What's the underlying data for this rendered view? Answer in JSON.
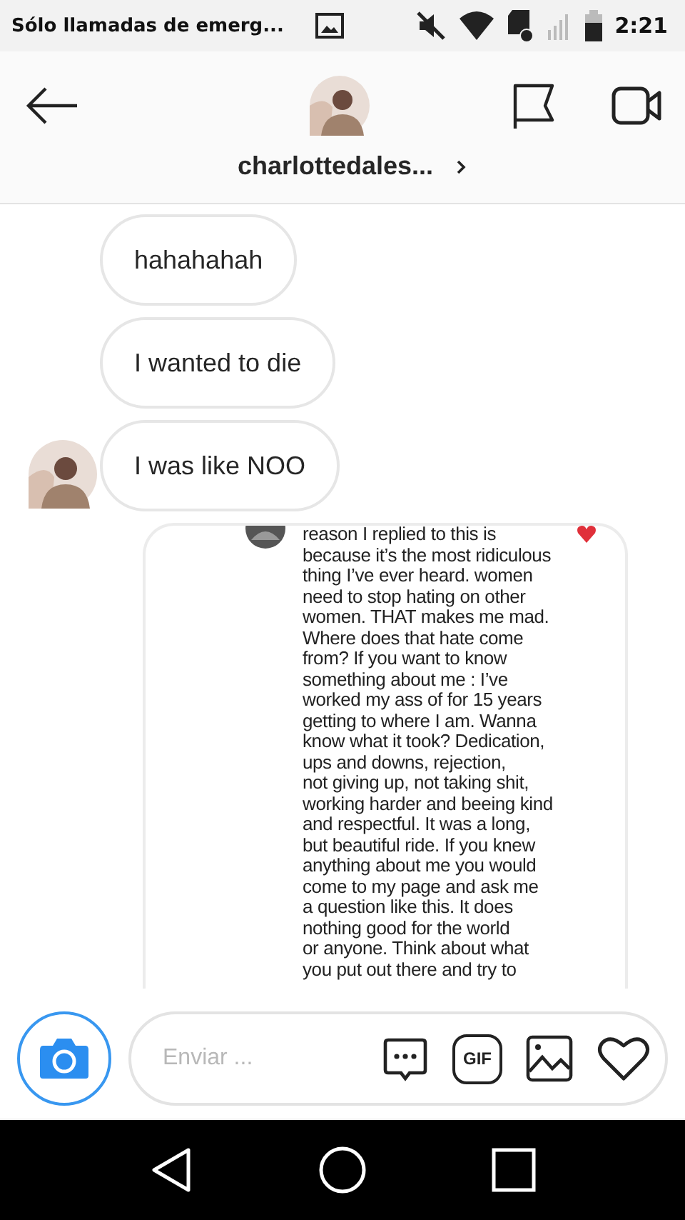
{
  "status_bar": {
    "notification": "Sólo llamadas de emerg...",
    "time": "2:21"
  },
  "header": {
    "username": "charlottedales..."
  },
  "messages": [
    {
      "kind": "text",
      "text": "hahahahah",
      "show_avatar": false
    },
    {
      "kind": "text",
      "text": "I wanted to die",
      "show_avatar": false
    },
    {
      "kind": "text",
      "text": "I was like NOO",
      "show_avatar": true
    },
    {
      "kind": "shared_image",
      "show_avatar": false,
      "lines": [
        "reason I replied to this is",
        "because it’s the most ridiculous",
        "thing I’ve ever heard. women",
        "need to stop hating on other",
        "women. THAT makes me mad.",
        "Where does that hate come",
        "from? If you want to know",
        "something about me : I’ve",
        "worked my ass of for 15 years",
        "getting to where I am. Wanna",
        "know what it took? Dedication,",
        "ups and downs, rejection,",
        "not giving up, not taking shit,",
        "working harder and beeing kind",
        "and respectful. It was a long,",
        "but beautiful ride. If you knew",
        "anything about me you would",
        "come to my page and ask me",
        "a question like this. It does",
        "nothing good for the world",
        "or anyone. Think about what",
        "you put out there and try to"
      ]
    }
  ],
  "composer": {
    "placeholder": "Enviar ...",
    "gif_label": "GIF"
  }
}
